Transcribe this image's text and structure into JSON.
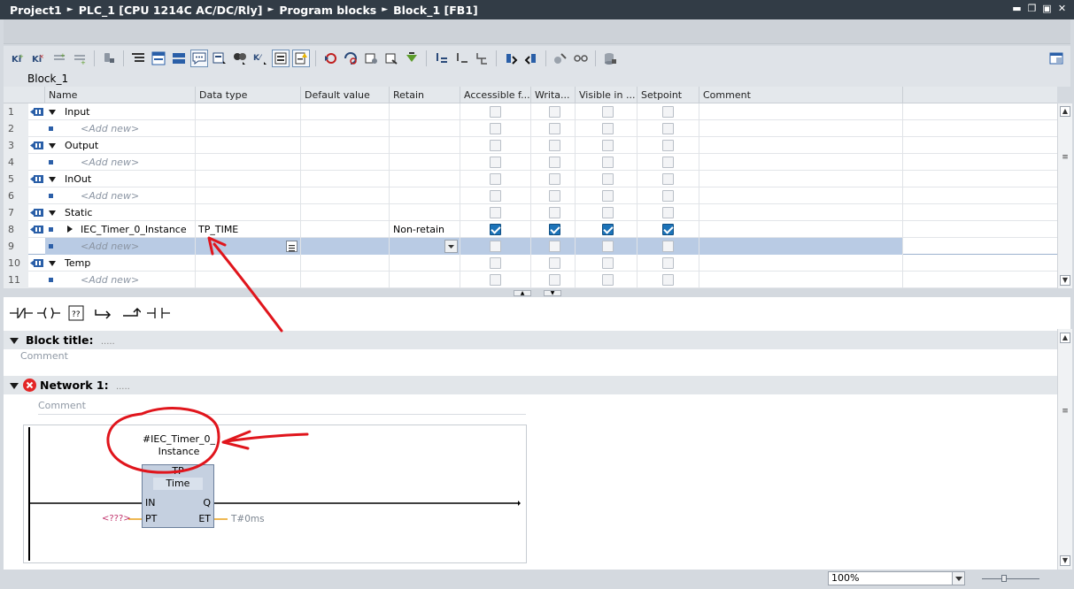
{
  "titlebar": {
    "breadcrumb": [
      "Project1",
      "PLC_1 [CPU 1214C AC/DC/Rly]",
      "Program blocks",
      "Block_1 [FB1]"
    ],
    "separator": "►"
  },
  "block_name": "Block_1",
  "interface_table": {
    "columns": [
      "Name",
      "Data type",
      "Default value",
      "Retain",
      "Accessible f...",
      "Writa...",
      "Visible in ...",
      "Setpoint",
      "Comment"
    ],
    "rows": [
      {
        "num": "1",
        "name": "Input",
        "type": "section",
        "datatype": "",
        "retain": "",
        "checks": [
          false,
          false,
          false,
          false
        ]
      },
      {
        "num": "2",
        "name": "<Add new>",
        "type": "add",
        "datatype": "",
        "retain": "",
        "checks": [
          false,
          false,
          false,
          false
        ]
      },
      {
        "num": "3",
        "name": "Output",
        "type": "section",
        "datatype": "",
        "retain": "",
        "checks": [
          false,
          false,
          false,
          false
        ]
      },
      {
        "num": "4",
        "name": "<Add new>",
        "type": "add",
        "datatype": "",
        "retain": "",
        "checks": [
          false,
          false,
          false,
          false
        ]
      },
      {
        "num": "5",
        "name": "InOut",
        "type": "section",
        "datatype": "",
        "retain": "",
        "checks": [
          false,
          false,
          false,
          false
        ]
      },
      {
        "num": "6",
        "name": "<Add new>",
        "type": "add",
        "datatype": "",
        "retain": "",
        "checks": [
          false,
          false,
          false,
          false
        ]
      },
      {
        "num": "7",
        "name": "Static",
        "type": "section",
        "datatype": "",
        "retain": "",
        "checks": [
          false,
          false,
          false,
          false
        ]
      },
      {
        "num": "8",
        "name": "IEC_Timer_0_Instance",
        "type": "var",
        "datatype": "TP_TIME",
        "retain": "Non-retain",
        "checks": [
          true,
          true,
          true,
          true
        ]
      },
      {
        "num": "9",
        "name": "<Add new>",
        "type": "add-selected",
        "datatype": "",
        "retain": "",
        "checks": [
          false,
          false,
          false,
          false
        ]
      },
      {
        "num": "10",
        "name": "Temp",
        "type": "section",
        "datatype": "",
        "retain": "",
        "checks": [
          false,
          false,
          false,
          false
        ]
      },
      {
        "num": "11",
        "name": "<Add new>",
        "type": "add",
        "datatype": "",
        "retain": "",
        "checks": [
          false,
          false,
          false,
          false
        ]
      }
    ]
  },
  "editor": {
    "block_title_label": "Block title:",
    "block_title_dots": ".....",
    "block_comment": "Comment",
    "network_label": "Network 1:",
    "network_dots": ".....",
    "network_comment": "Comment",
    "instance_line1": "#IEC_Timer_0_",
    "instance_line2": "Instance",
    "fb_type": "TP",
    "fb_subtype": "Time",
    "pin_in": "IN",
    "pin_pt": "PT",
    "pin_q": "Q",
    "pin_et": "ET",
    "pt_value": "<???>",
    "et_value": "T#0ms"
  },
  "status": {
    "zoom": "100%"
  },
  "colors": {
    "titlebar": "#323c46",
    "checkbox_on": "#1c73b8",
    "selected_row": "#b9cbe4",
    "annotation": "#e0151c",
    "error": "#e32626"
  }
}
